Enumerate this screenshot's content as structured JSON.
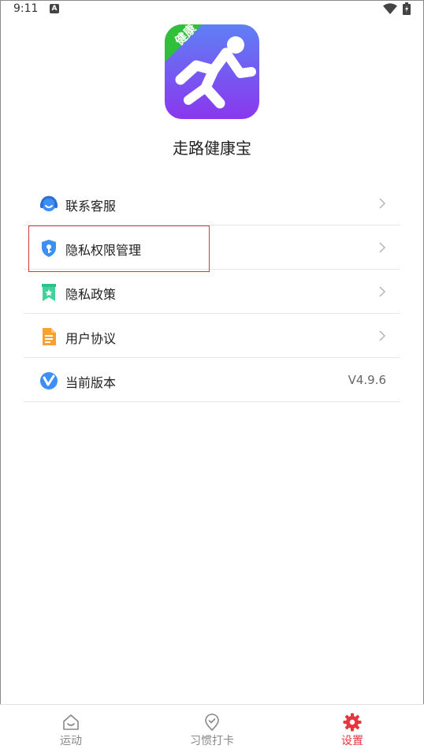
{
  "status_bar": {
    "time": "9:11",
    "notification_letter": "A"
  },
  "app": {
    "name": "走路健康宝",
    "badge_text": "健康"
  },
  "menu": {
    "items": [
      {
        "label": "联系客服",
        "icon": "customer-service-icon"
      },
      {
        "label": "隐私权限管理",
        "icon": "privacy-shield-icon"
      },
      {
        "label": "隐私政策",
        "icon": "bookmark-star-icon"
      },
      {
        "label": "用户协议",
        "icon": "document-icon"
      },
      {
        "label": "当前版本",
        "icon": "version-v-icon",
        "value": "V4.9.6"
      }
    ]
  },
  "bottom_nav": {
    "tabs": [
      {
        "label": "运动",
        "icon": "home-smile-icon"
      },
      {
        "label": "习惯打卡",
        "icon": "checkin-pin-icon"
      },
      {
        "label": "设置",
        "icon": "gear-icon",
        "active": true
      }
    ]
  },
  "colors": {
    "accent": "#e8363f",
    "logo_purple": "#7b4df5",
    "badge_green": "#35c13a"
  }
}
